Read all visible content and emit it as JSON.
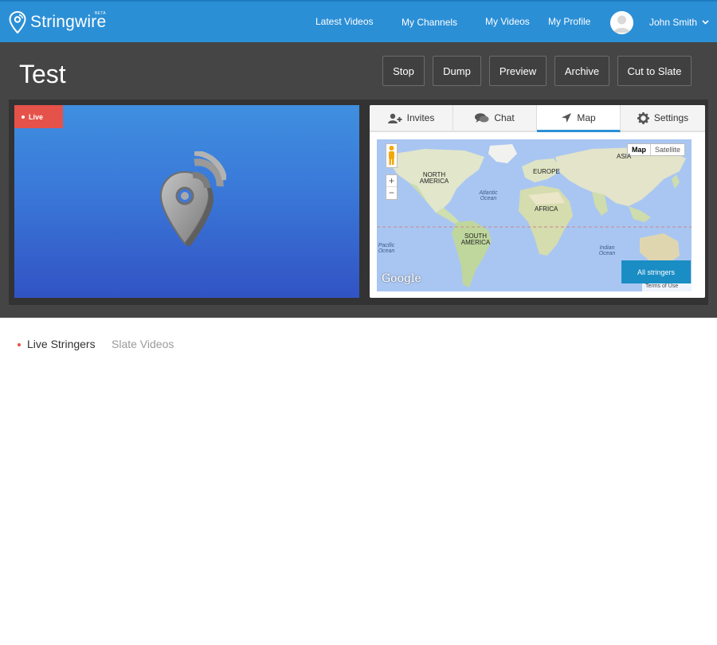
{
  "nav": {
    "brand": "Stringwire",
    "brand_badge": "BETA",
    "links": [
      "Latest Videos",
      "My Channels",
      "My Videos",
      "My Profile"
    ],
    "user_name": "John Smith"
  },
  "header": {
    "title": "Test",
    "buttons": [
      "Stop",
      "Dump",
      "Preview",
      "Archive",
      "Cut to Slate"
    ]
  },
  "video": {
    "status_badge": "Live"
  },
  "side_panel": {
    "tabs": [
      {
        "label": "Invites",
        "icon": "add-user-icon"
      },
      {
        "label": "Chat",
        "icon": "chat-icon"
      },
      {
        "label": "Map",
        "icon": "navigation-arrow-icon",
        "active": true
      },
      {
        "label": "Settings",
        "icon": "gear-icon"
      }
    ],
    "map": {
      "type_toggle": [
        "Map",
        "Satellite"
      ],
      "selected_type": "Map",
      "zoom_in": "+",
      "zoom_out": "−",
      "labels": {
        "north_america": "NORTH AMERICA",
        "europe": "EUROPE",
        "asia": "ASIA",
        "africa": "AFRICA",
        "south_america": "SOUTH AMERICA",
        "atlantic": "Atlantic Ocean",
        "pacific": "Pacific Ocean",
        "indian": "Indian Ocean"
      },
      "filter_button": "All stringers",
      "terms": "Terms of Use",
      "attribution": "Google"
    }
  },
  "lower_tabs": {
    "active": "Live Stringers",
    "inactive": "Slate Videos"
  },
  "colors": {
    "nav_blue": "#2b8fd6",
    "band_dark": "#454545",
    "live_red": "#e5524a",
    "accent_blue": "#1a8dc4"
  }
}
